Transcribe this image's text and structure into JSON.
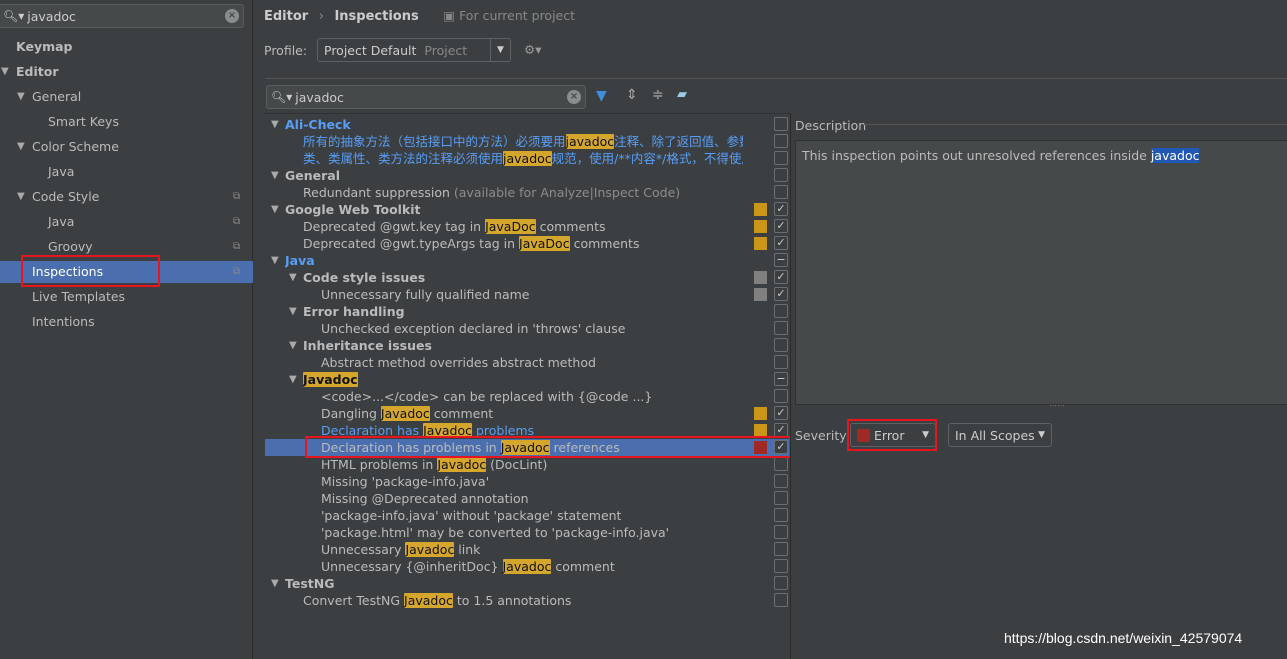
{
  "sidebar": {
    "search": "javadoc",
    "items": [
      {
        "label": "Keymap",
        "level": 0,
        "bold": true,
        "arrow": false
      },
      {
        "label": "Editor",
        "level": 0,
        "bold": true,
        "arrow": true
      },
      {
        "label": "General",
        "level": 1,
        "arrow": true
      },
      {
        "label": "Smart Keys",
        "level": 2
      },
      {
        "label": "Color Scheme",
        "level": 1,
        "arrow": true
      },
      {
        "label": "Java",
        "level": 2
      },
      {
        "label": "Code Style",
        "level": 1,
        "arrow": true,
        "copy": true
      },
      {
        "label": "Java",
        "level": 2,
        "copy": true
      },
      {
        "label": "Groovy",
        "level": 2,
        "copy": true
      },
      {
        "label": "Inspections",
        "level": 1,
        "selected": true,
        "copy": true
      },
      {
        "label": "Live Templates",
        "level": 1
      },
      {
        "label": "Intentions",
        "level": 1
      }
    ]
  },
  "header": {
    "crumb1": "Editor",
    "sep": "›",
    "crumb2": "Inspections",
    "scope_note": "For current project"
  },
  "profile": {
    "label": "Profile:",
    "value": "Project Default",
    "type": "Project"
  },
  "filter": {
    "search": "javadoc"
  },
  "colors": {
    "accent": "#4b6eaf",
    "warning": "#c9961a",
    "weak": "#808080",
    "error": "#9e2927",
    "highlight": "#d4a72c",
    "link": "#589df6"
  },
  "tree": [
    {
      "lv": 0,
      "group": true,
      "blue": true,
      "parts": [
        {
          "t": "Ali-Check"
        }
      ],
      "check": "off"
    },
    {
      "lv": 1,
      "blue": true,
      "parts": [
        {
          "t": "所有的抽象方法（包括接口中的方法）必须要用"
        },
        {
          "t": "javadoc",
          "hl": true
        },
        {
          "t": "注释、除了返回值、参数、异"
        }
      ],
      "check": "off"
    },
    {
      "lv": 1,
      "blue": true,
      "parts": [
        {
          "t": "类、类属性、类方法的注释必须使用"
        },
        {
          "t": "javadoc",
          "hl": true
        },
        {
          "t": "规范，使用/**内容*/格式，不得使用//x"
        }
      ],
      "check": "off"
    },
    {
      "lv": 0,
      "group": true,
      "parts": [
        {
          "t": "General"
        }
      ],
      "check": "off"
    },
    {
      "lv": 1,
      "parts": [
        {
          "t": "Redundant suppression "
        },
        {
          "t": "(available for Analyze|Inspect Code)",
          "dim": true
        }
      ],
      "check": "off"
    },
    {
      "lv": 0,
      "group": true,
      "parts": [
        {
          "t": "Google Web Toolkit"
        }
      ],
      "sev": "warning",
      "check": "on"
    },
    {
      "lv": 1,
      "parts": [
        {
          "t": "Deprecated @gwt.key tag in "
        },
        {
          "t": "JavaDoc",
          "hl": true
        },
        {
          "t": " comments"
        }
      ],
      "sev": "warning",
      "check": "on"
    },
    {
      "lv": 1,
      "parts": [
        {
          "t": "Deprecated @gwt.typeArgs tag in "
        },
        {
          "t": "JavaDoc",
          "hl": true
        },
        {
          "t": " comments"
        }
      ],
      "sev": "warning",
      "check": "on"
    },
    {
      "lv": 0,
      "group": true,
      "blue": true,
      "parts": [
        {
          "t": "Java"
        }
      ],
      "check": "mixed"
    },
    {
      "lv": 1,
      "group": true,
      "parts": [
        {
          "t": "Code style issues"
        }
      ],
      "sev": "weak",
      "check": "on"
    },
    {
      "lv": 2,
      "parts": [
        {
          "t": "Unnecessary fully qualified name"
        }
      ],
      "sev": "weak",
      "check": "on"
    },
    {
      "lv": 1,
      "group": true,
      "parts": [
        {
          "t": "Error handling"
        }
      ],
      "check": "off"
    },
    {
      "lv": 2,
      "parts": [
        {
          "t": "Unchecked exception declared in 'throws' clause"
        }
      ],
      "check": "off"
    },
    {
      "lv": 1,
      "group": true,
      "parts": [
        {
          "t": "Inheritance issues"
        }
      ],
      "check": "off"
    },
    {
      "lv": 2,
      "parts": [
        {
          "t": "Abstract method overrides abstract method"
        }
      ],
      "check": "off"
    },
    {
      "lv": 1,
      "group": true,
      "parts": [
        {
          "t": "Javadoc",
          "hl": true
        }
      ],
      "check": "mixed"
    },
    {
      "lv": 2,
      "parts": [
        {
          "t": "<code>...</code> can be replaced with {@code ...}"
        }
      ],
      "check": "off"
    },
    {
      "lv": 2,
      "parts": [
        {
          "t": "Dangling "
        },
        {
          "t": "Javadoc",
          "hl": true
        },
        {
          "t": " comment"
        }
      ],
      "sev": "warning",
      "check": "on"
    },
    {
      "lv": 2,
      "blue": true,
      "parts": [
        {
          "t": "Declaration has "
        },
        {
          "t": "Javadoc",
          "hl": true
        },
        {
          "t": " problems"
        }
      ],
      "sev": "warning",
      "check": "on"
    },
    {
      "lv": 2,
      "selected": true,
      "parts": [
        {
          "t": "Declaration has problems in "
        },
        {
          "t": "Javadoc",
          "hl": true
        },
        {
          "t": " references"
        }
      ],
      "sev": "error",
      "check": "on"
    },
    {
      "lv": 2,
      "parts": [
        {
          "t": "HTML problems in "
        },
        {
          "t": "Javadoc",
          "hl": true
        },
        {
          "t": " (DocLint)"
        }
      ],
      "check": "off"
    },
    {
      "lv": 2,
      "parts": [
        {
          "t": "Missing 'package-info.java'"
        }
      ],
      "check": "off"
    },
    {
      "lv": 2,
      "parts": [
        {
          "t": "Missing @Deprecated annotation"
        }
      ],
      "check": "off"
    },
    {
      "lv": 2,
      "parts": [
        {
          "t": "'package-info.java' without 'package' statement"
        }
      ],
      "check": "off"
    },
    {
      "lv": 2,
      "parts": [
        {
          "t": "'package.html' may be converted to 'package-info.java'"
        }
      ],
      "check": "off"
    },
    {
      "lv": 2,
      "parts": [
        {
          "t": "Unnecessary "
        },
        {
          "t": "Javadoc",
          "hl": true
        },
        {
          "t": " link"
        }
      ],
      "check": "off"
    },
    {
      "lv": 2,
      "parts": [
        {
          "t": "Unnecessary {@inheritDoc} "
        },
        {
          "t": "Javadoc",
          "hl": true
        },
        {
          "t": " comment"
        }
      ],
      "check": "off"
    },
    {
      "lv": 0,
      "group": true,
      "parts": [
        {
          "t": "TestNG"
        }
      ],
      "check": "off"
    },
    {
      "lv": 1,
      "parts": [
        {
          "t": "Convert TestNG "
        },
        {
          "t": "Javadoc",
          "hl": true
        },
        {
          "t": " to 1.5 annotations"
        }
      ],
      "check": "off"
    }
  ],
  "description": {
    "title": "Description",
    "text": "This inspection points out unresolved references inside ",
    "highlight": "javadoc"
  },
  "severity": {
    "label": "Severity:",
    "value": "Error",
    "scope": "In All Scopes"
  },
  "watermark": "https://blog.csdn.net/weixin_42579074"
}
